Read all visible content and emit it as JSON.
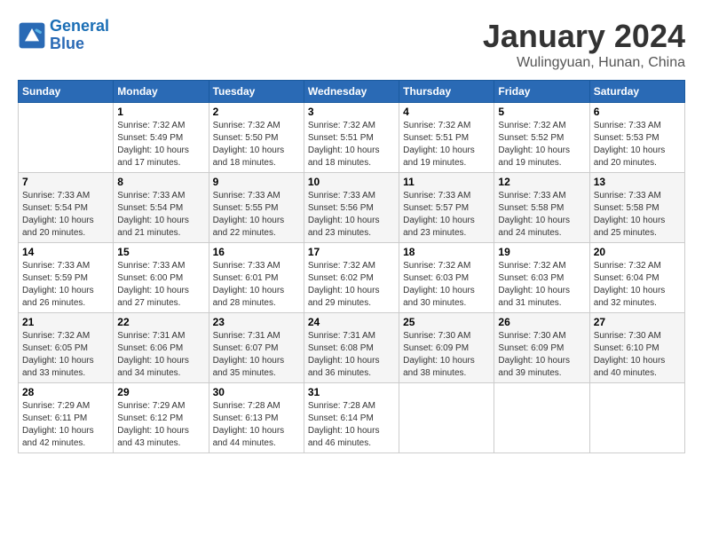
{
  "header": {
    "logo_line1": "General",
    "logo_line2": "Blue",
    "title": "January 2024",
    "location": "Wulingyuan, Hunan, China"
  },
  "days_of_week": [
    "Sunday",
    "Monday",
    "Tuesday",
    "Wednesday",
    "Thursday",
    "Friday",
    "Saturday"
  ],
  "weeks": [
    [
      {
        "num": "",
        "info": ""
      },
      {
        "num": "1",
        "info": "Sunrise: 7:32 AM\nSunset: 5:49 PM\nDaylight: 10 hours\nand 17 minutes."
      },
      {
        "num": "2",
        "info": "Sunrise: 7:32 AM\nSunset: 5:50 PM\nDaylight: 10 hours\nand 18 minutes."
      },
      {
        "num": "3",
        "info": "Sunrise: 7:32 AM\nSunset: 5:51 PM\nDaylight: 10 hours\nand 18 minutes."
      },
      {
        "num": "4",
        "info": "Sunrise: 7:32 AM\nSunset: 5:51 PM\nDaylight: 10 hours\nand 19 minutes."
      },
      {
        "num": "5",
        "info": "Sunrise: 7:32 AM\nSunset: 5:52 PM\nDaylight: 10 hours\nand 19 minutes."
      },
      {
        "num": "6",
        "info": "Sunrise: 7:33 AM\nSunset: 5:53 PM\nDaylight: 10 hours\nand 20 minutes."
      }
    ],
    [
      {
        "num": "7",
        "info": "Sunrise: 7:33 AM\nSunset: 5:54 PM\nDaylight: 10 hours\nand 20 minutes."
      },
      {
        "num": "8",
        "info": "Sunrise: 7:33 AM\nSunset: 5:54 PM\nDaylight: 10 hours\nand 21 minutes."
      },
      {
        "num": "9",
        "info": "Sunrise: 7:33 AM\nSunset: 5:55 PM\nDaylight: 10 hours\nand 22 minutes."
      },
      {
        "num": "10",
        "info": "Sunrise: 7:33 AM\nSunset: 5:56 PM\nDaylight: 10 hours\nand 23 minutes."
      },
      {
        "num": "11",
        "info": "Sunrise: 7:33 AM\nSunset: 5:57 PM\nDaylight: 10 hours\nand 23 minutes."
      },
      {
        "num": "12",
        "info": "Sunrise: 7:33 AM\nSunset: 5:58 PM\nDaylight: 10 hours\nand 24 minutes."
      },
      {
        "num": "13",
        "info": "Sunrise: 7:33 AM\nSunset: 5:58 PM\nDaylight: 10 hours\nand 25 minutes."
      }
    ],
    [
      {
        "num": "14",
        "info": "Sunrise: 7:33 AM\nSunset: 5:59 PM\nDaylight: 10 hours\nand 26 minutes."
      },
      {
        "num": "15",
        "info": "Sunrise: 7:33 AM\nSunset: 6:00 PM\nDaylight: 10 hours\nand 27 minutes."
      },
      {
        "num": "16",
        "info": "Sunrise: 7:33 AM\nSunset: 6:01 PM\nDaylight: 10 hours\nand 28 minutes."
      },
      {
        "num": "17",
        "info": "Sunrise: 7:32 AM\nSunset: 6:02 PM\nDaylight: 10 hours\nand 29 minutes."
      },
      {
        "num": "18",
        "info": "Sunrise: 7:32 AM\nSunset: 6:03 PM\nDaylight: 10 hours\nand 30 minutes."
      },
      {
        "num": "19",
        "info": "Sunrise: 7:32 AM\nSunset: 6:03 PM\nDaylight: 10 hours\nand 31 minutes."
      },
      {
        "num": "20",
        "info": "Sunrise: 7:32 AM\nSunset: 6:04 PM\nDaylight: 10 hours\nand 32 minutes."
      }
    ],
    [
      {
        "num": "21",
        "info": "Sunrise: 7:32 AM\nSunset: 6:05 PM\nDaylight: 10 hours\nand 33 minutes."
      },
      {
        "num": "22",
        "info": "Sunrise: 7:31 AM\nSunset: 6:06 PM\nDaylight: 10 hours\nand 34 minutes."
      },
      {
        "num": "23",
        "info": "Sunrise: 7:31 AM\nSunset: 6:07 PM\nDaylight: 10 hours\nand 35 minutes."
      },
      {
        "num": "24",
        "info": "Sunrise: 7:31 AM\nSunset: 6:08 PM\nDaylight: 10 hours\nand 36 minutes."
      },
      {
        "num": "25",
        "info": "Sunrise: 7:30 AM\nSunset: 6:09 PM\nDaylight: 10 hours\nand 38 minutes."
      },
      {
        "num": "26",
        "info": "Sunrise: 7:30 AM\nSunset: 6:09 PM\nDaylight: 10 hours\nand 39 minutes."
      },
      {
        "num": "27",
        "info": "Sunrise: 7:30 AM\nSunset: 6:10 PM\nDaylight: 10 hours\nand 40 minutes."
      }
    ],
    [
      {
        "num": "28",
        "info": "Sunrise: 7:29 AM\nSunset: 6:11 PM\nDaylight: 10 hours\nand 42 minutes."
      },
      {
        "num": "29",
        "info": "Sunrise: 7:29 AM\nSunset: 6:12 PM\nDaylight: 10 hours\nand 43 minutes."
      },
      {
        "num": "30",
        "info": "Sunrise: 7:28 AM\nSunset: 6:13 PM\nDaylight: 10 hours\nand 44 minutes."
      },
      {
        "num": "31",
        "info": "Sunrise: 7:28 AM\nSunset: 6:14 PM\nDaylight: 10 hours\nand 46 minutes."
      },
      {
        "num": "",
        "info": ""
      },
      {
        "num": "",
        "info": ""
      },
      {
        "num": "",
        "info": ""
      }
    ]
  ]
}
